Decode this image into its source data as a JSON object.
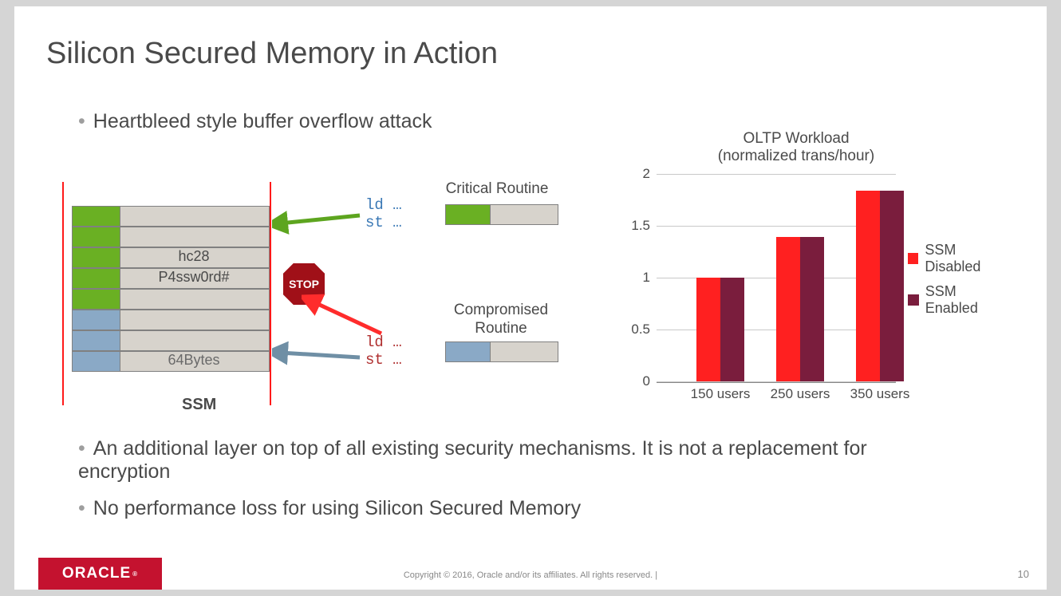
{
  "title": "Silicon Secured Memory in Action",
  "bullets": {
    "b1": "Heartbleed style buffer overflow attack",
    "b2": "An additional layer on top of all existing security mechanisms.  It is not a replacement for encryption",
    "b3": "No performance loss for using Silicon Secured Memory"
  },
  "diagram": {
    "row_hc28": "hc28",
    "row_pwd": "P4ssw0rd#",
    "row_64b": "64Bytes",
    "ssm": "SSM",
    "critical": "Critical Routine",
    "compromised_l1": "Compromised",
    "compromised_l2": "Routine",
    "code_ld": "ld …",
    "code_st": "st …",
    "stop": "STOP"
  },
  "chart_data": {
    "type": "bar",
    "title": "OLTP Workload\n(normalized trans/hour)",
    "ylabel": "",
    "ylim": [
      0,
      2
    ],
    "yticks": [
      0,
      0.5,
      1,
      1.5,
      2
    ],
    "categories": [
      "150 users",
      "250 users",
      "350 users"
    ],
    "series": [
      {
        "name": "SSM Disabled",
        "values": [
          1.0,
          1.39,
          1.84
        ],
        "color": "#ff2020"
      },
      {
        "name": "SSM Enabled",
        "values": [
          1.0,
          1.39,
          1.84
        ],
        "color": "#7a1d3d"
      }
    ]
  },
  "footer": {
    "brand": "ORACLE",
    "copyright": "Copyright © 2016, Oracle and/or its affiliates. All rights reserved.  |",
    "page": "10"
  }
}
